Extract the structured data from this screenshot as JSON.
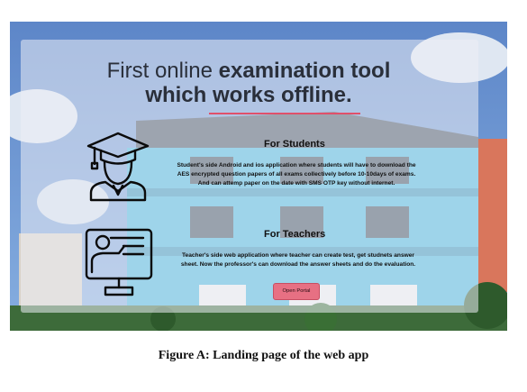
{
  "hero": {
    "line1_prefix": "First online ",
    "line1_bold": "examination tool",
    "line2": "which works offline."
  },
  "students": {
    "title": "For Students",
    "text": "Student's side Android and ios application where students will have to download the AES encrypted question papers of all exams collectively before 10-10days of exams. And can attemp paper on the date with SMS OTP key without internet."
  },
  "teachers": {
    "title": "For Teachers",
    "text": "Teacher's side web application where teacher can create test, get studnets answer sheet. Now the professor's can download the answer sheets and do the evaluation."
  },
  "cta": {
    "label": "Open Portal"
  },
  "icons": {
    "students": "graduate-student-icon",
    "teachers": "teacher-presentation-icon"
  },
  "colors": {
    "accent": "#e77083",
    "underline": "#e0506a"
  },
  "caption": "Figure A: Landing page of the web app"
}
